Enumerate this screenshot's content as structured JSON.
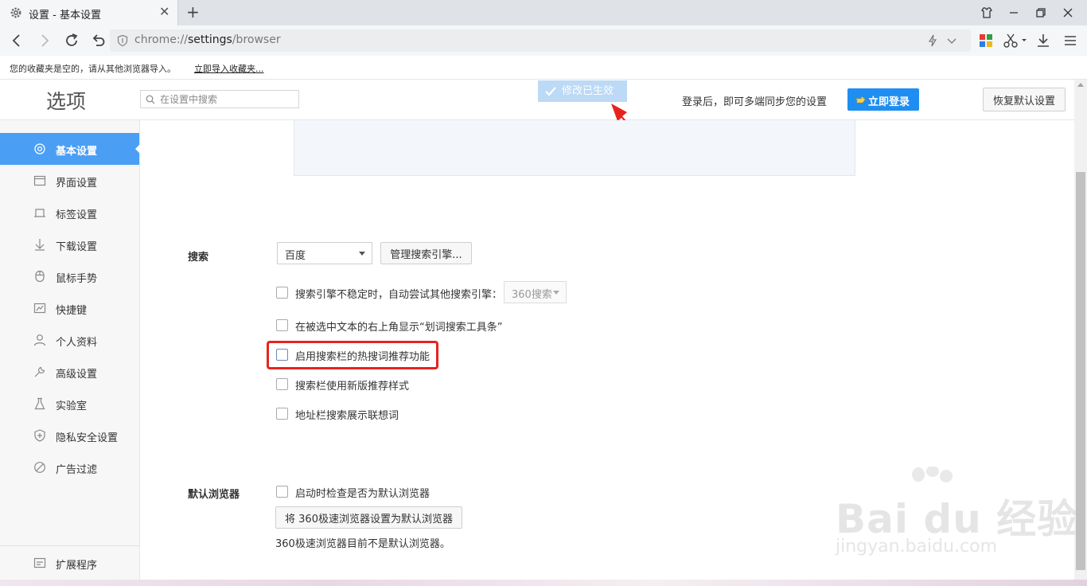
{
  "browser": {
    "tab_title": "设置 - 基本设置",
    "url_scheme": "chrome://",
    "url_host": "settings",
    "url_path": "/browser"
  },
  "bookmark_bar": {
    "empty_text": "您的收藏夹是空的，请从其他浏览器导入。",
    "import_link": "立即导入收藏夹..."
  },
  "header": {
    "title": "选项",
    "search_placeholder": "在设置中搜索",
    "toast": "修改已生效",
    "sync_text": "登录后，即可多端同步您的设置",
    "login_label": "立即登录",
    "reset_label": "恢复默认设置"
  },
  "sidebar": {
    "items": [
      {
        "label": "基本设置",
        "icon": "target-icon",
        "active": true
      },
      {
        "label": "界面设置",
        "icon": "window-icon"
      },
      {
        "label": "标签设置",
        "icon": "tab-icon"
      },
      {
        "label": "下载设置",
        "icon": "download-icon"
      },
      {
        "label": "鼠标手势",
        "icon": "mouse-icon"
      },
      {
        "label": "快捷键",
        "icon": "keyboard-icon"
      },
      {
        "label": "个人资料",
        "icon": "user-icon"
      },
      {
        "label": "高级设置",
        "icon": "wrench-icon"
      },
      {
        "label": "实验室",
        "icon": "flask-icon"
      },
      {
        "label": "隐私安全设置",
        "icon": "shield-icon"
      },
      {
        "label": "广告过滤",
        "icon": "block-icon"
      }
    ],
    "extensions_label": "扩展程序"
  },
  "search_section": {
    "label": "搜索",
    "engine_value": "百度",
    "manage_button": "管理搜索引擎...",
    "options": [
      {
        "label": "搜索引擎不稳定时，自动尝试其他搜索引擎：",
        "checked": false
      },
      {
        "label": "在被选中文本的右上角显示“划词搜索工具条”",
        "checked": false
      },
      {
        "label": "启用搜索栏的热搜词推荐功能",
        "checked": false
      },
      {
        "label": "搜索栏使用新版推荐样式",
        "checked": false
      },
      {
        "label": "地址栏搜索展示联想词",
        "checked": false
      }
    ],
    "fallback_engine_value": "360搜索"
  },
  "default_browser_section": {
    "label": "默认浏览器",
    "check_option": "启动时检查是否为默认浏览器",
    "set_button": "将 360极速浏览器设置为默认浏览器",
    "status_text": "360极速浏览器目前不是默认浏览器。"
  },
  "watermark": {
    "brand": "Bai du 经验",
    "domain": "jingyan.baidu.com"
  },
  "colors": {
    "accent": "#4a9ff5",
    "login_button": "#1e8ef2",
    "highlight": "#e8231e"
  }
}
